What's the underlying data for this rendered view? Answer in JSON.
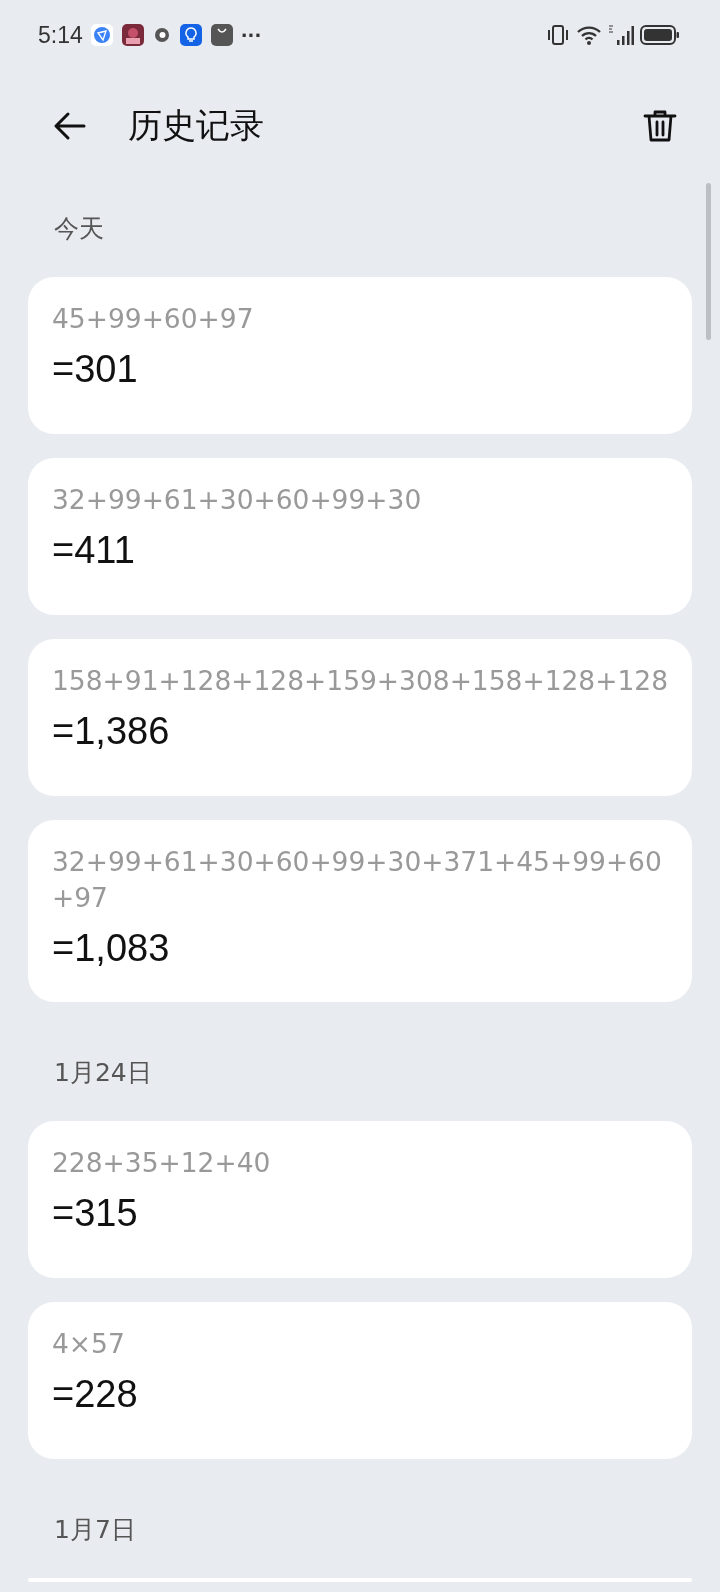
{
  "status_bar": {
    "time": "5:14",
    "more": "···"
  },
  "header": {
    "title": "历史记录"
  },
  "groups": [
    {
      "label": "今天",
      "entries": [
        {
          "expression": "45+99+60+97",
          "result": "=301"
        },
        {
          "expression": "32+99+61+30+60+99+30",
          "result": "=411"
        },
        {
          "expression": "158+91+128+128+159+308+158+128+128",
          "result": "=1,386"
        },
        {
          "expression": "32+99+61+30+60+99+30+371+45+99+60+97",
          "result": "=1,083"
        }
      ]
    },
    {
      "label": "1月24日",
      "entries": [
        {
          "expression": "228+35+12+40",
          "result": "=315"
        },
        {
          "expression": "4×57",
          "result": "=228"
        }
      ]
    },
    {
      "label": "1月7日"
    }
  ]
}
